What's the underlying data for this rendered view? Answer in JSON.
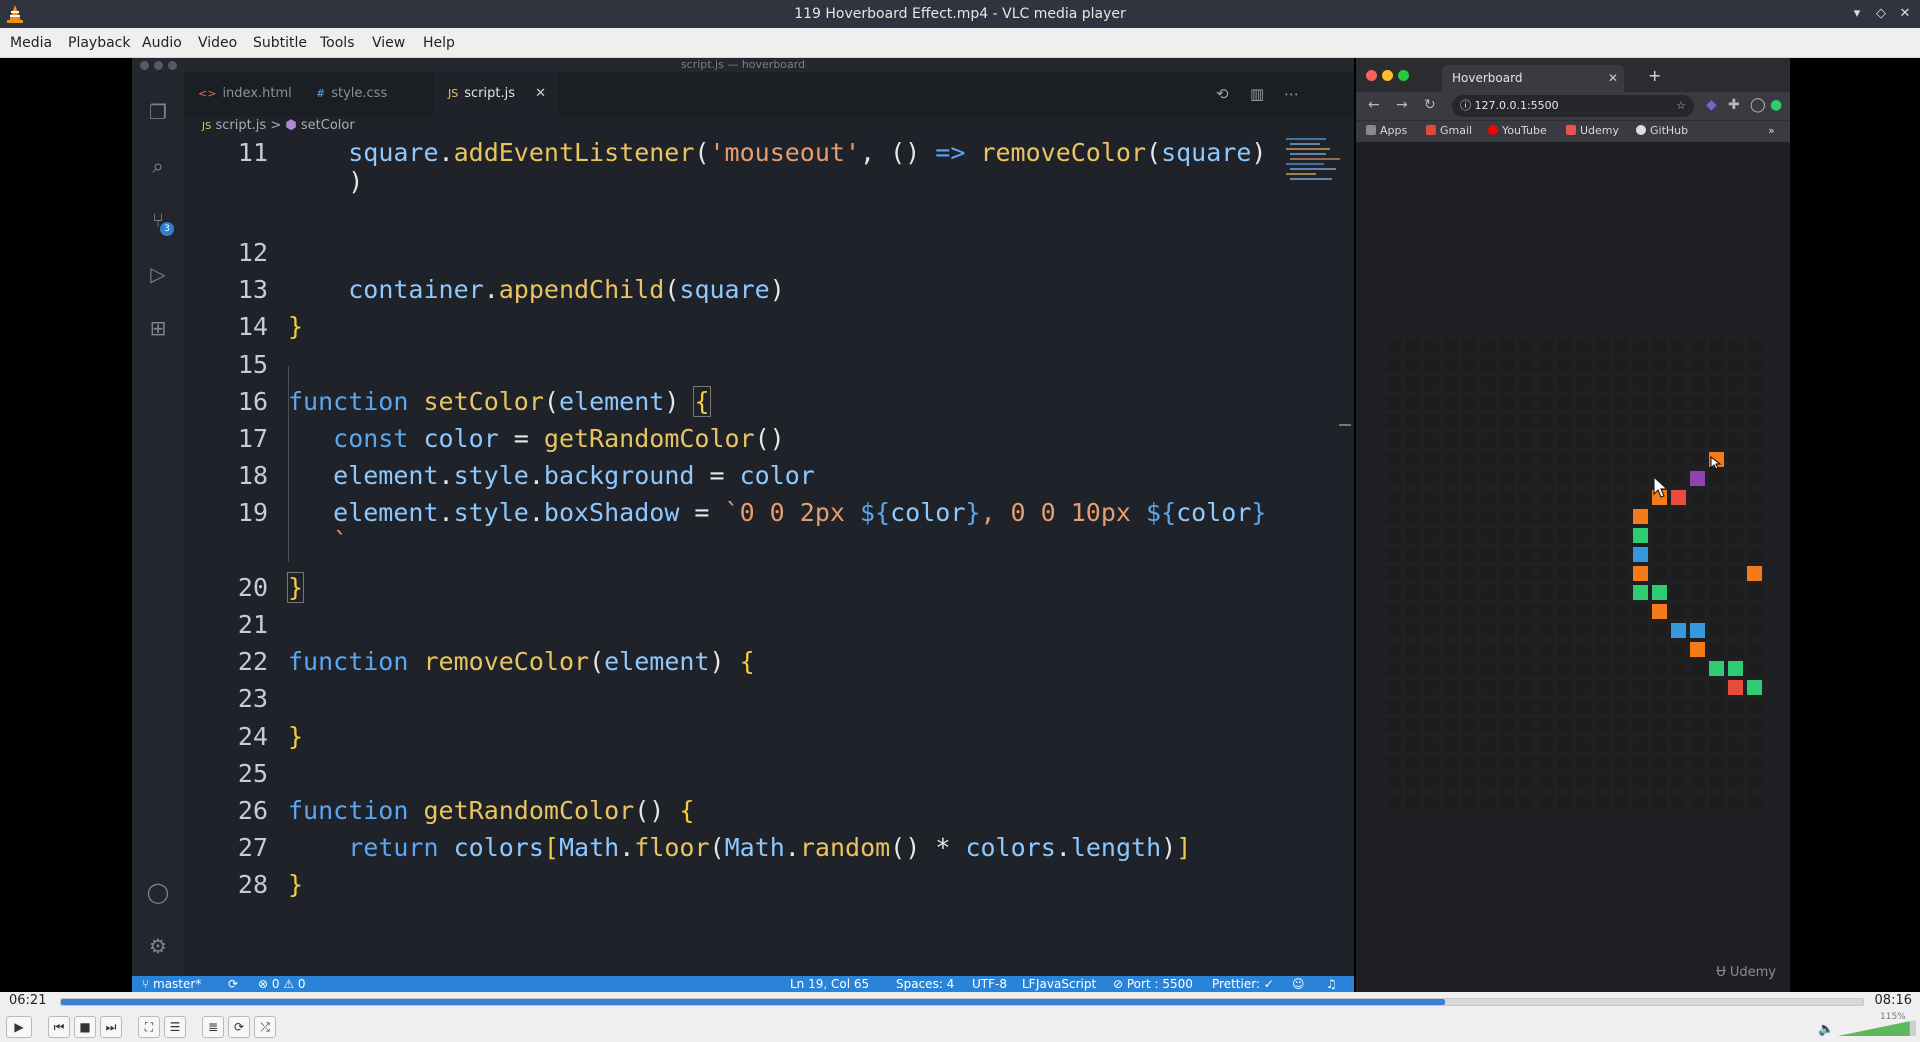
{
  "window": {
    "title": "119 Hoverboard Effect.mp4 - VLC media player"
  },
  "menu": [
    "Media",
    "Playback",
    "Audio",
    "Video",
    "Subtitle",
    "Tools",
    "View",
    "Help"
  ],
  "vscode": {
    "title": "script.js — hoverboard",
    "tabs": [
      {
        "icon": "<>",
        "label": "index.html"
      },
      {
        "icon": "#",
        "label": "style.css"
      },
      {
        "icon": "JS",
        "label": "script.js"
      }
    ],
    "tab_close": "✕",
    "breadcrumb": {
      "file": "script.js",
      "separator": ">",
      "symbol": "setColor"
    },
    "scm_badge": "3",
    "line_numbers": [
      "11",
      "12",
      "13",
      "14",
      "15",
      "16",
      "17",
      "18",
      "19",
      "20",
      "21",
      "22",
      "23",
      "24",
      "25",
      "26",
      "27",
      "28"
    ],
    "status": {
      "branch": "master*",
      "problems": "⊗ 0 ⚠ 0",
      "position": "Ln 19, Col 65",
      "spaces": "Spaces: 4",
      "encoding": "UTF-8",
      "eol": "LF",
      "language": "JavaScript",
      "port": "⊘ Port : 5500",
      "prettier": "Prettier: ✓"
    }
  },
  "browser": {
    "tab_title": "Hoverboard",
    "url": "127.0.0.1:5500",
    "bookmarks": [
      "Apps",
      "Gmail",
      "YouTube",
      "Udemy",
      "GitHub"
    ],
    "watermark": "Udemy",
    "grid": {
      "cols": 20,
      "rows": 25,
      "base_color": "#1d1d1d",
      "lit": [
        {
          "col": 17,
          "row": 6,
          "color": "#f47b17"
        },
        {
          "col": 16,
          "row": 7,
          "color": "#8e44ad"
        },
        {
          "col": 14,
          "row": 8,
          "color": "#f47b17"
        },
        {
          "col": 15,
          "row": 8,
          "color": "#e74c3c"
        },
        {
          "col": 13,
          "row": 9,
          "color": "#f47b17"
        },
        {
          "col": 13,
          "row": 10,
          "color": "#2ecc71"
        },
        {
          "col": 13,
          "row": 11,
          "color": "#3498db"
        },
        {
          "col": 13,
          "row": 12,
          "color": "#f47b17"
        },
        {
          "col": 19,
          "row": 12,
          "color": "#f47b17"
        },
        {
          "col": 13,
          "row": 13,
          "color": "#2ecc71"
        },
        {
          "col": 14,
          "row": 13,
          "color": "#2ecc71"
        },
        {
          "col": 14,
          "row": 14,
          "color": "#f47b17"
        },
        {
          "col": 15,
          "row": 15,
          "color": "#3498db"
        },
        {
          "col": 16,
          "row": 15,
          "color": "#3498db"
        },
        {
          "col": 16,
          "row": 16,
          "color": "#f47b17"
        },
        {
          "col": 17,
          "row": 17,
          "color": "#2ecc71"
        },
        {
          "col": 18,
          "row": 17,
          "color": "#2ecc71"
        },
        {
          "col": 18,
          "row": 18,
          "color": "#e74c3c"
        },
        {
          "col": 19,
          "row": 18,
          "color": "#2ecc71"
        }
      ]
    }
  },
  "player": {
    "elapsed": "06:21",
    "total": "08:16",
    "progress": 0.768,
    "volume_label": "115%",
    "volume": 1.15
  },
  "colors": {
    "accent": "#3b7fd4",
    "statusbar": "#2a83d7"
  }
}
